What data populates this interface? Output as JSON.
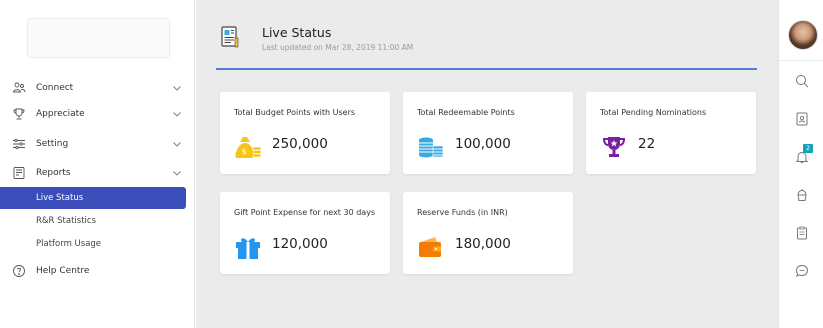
{
  "sidebar": {
    "items": [
      {
        "label": "Connect",
        "icon": "people-icon"
      },
      {
        "label": "Appreciate",
        "icon": "trophy-icon"
      },
      {
        "label": "Setting",
        "icon": "sliders-icon"
      },
      {
        "label": "Reports",
        "icon": "report-icon"
      }
    ],
    "sub_items": [
      {
        "label": "Live Status",
        "active": true
      },
      {
        "label": "R&R Statistics"
      },
      {
        "label": "Platform Usage"
      }
    ],
    "help": {
      "label": "Help Centre",
      "icon": "help-icon"
    }
  },
  "header": {
    "title": "Live Status",
    "updated": "Last updated on Mar 28, 2019  11:00 AM"
  },
  "cards": [
    {
      "title": "Total Budget Points with Users",
      "value": "250,000",
      "icon": "money-bag-icon",
      "color": "#f5c518"
    },
    {
      "title": "Total Redeemable Points",
      "value": "100,000",
      "icon": "coins-stack-icon",
      "color": "#3aa9e0"
    },
    {
      "title": "Total Pending Nominations",
      "value": "22",
      "icon": "trophy-icon",
      "color": "#7b1fa2"
    },
    {
      "title": "Gift Point Expense for next 30 days",
      "value": "120,000",
      "icon": "gift-icon",
      "color": "#2196f3"
    },
    {
      "title": "Reserve Funds (in INR)",
      "value": "180,000",
      "icon": "wallet-icon",
      "color": "#f57c00"
    }
  ],
  "rail": {
    "notification_count": "2"
  },
  "colors": {
    "accent": "#3b4db8",
    "header_line": "#5a7bd3",
    "background": "#ebebeb"
  }
}
